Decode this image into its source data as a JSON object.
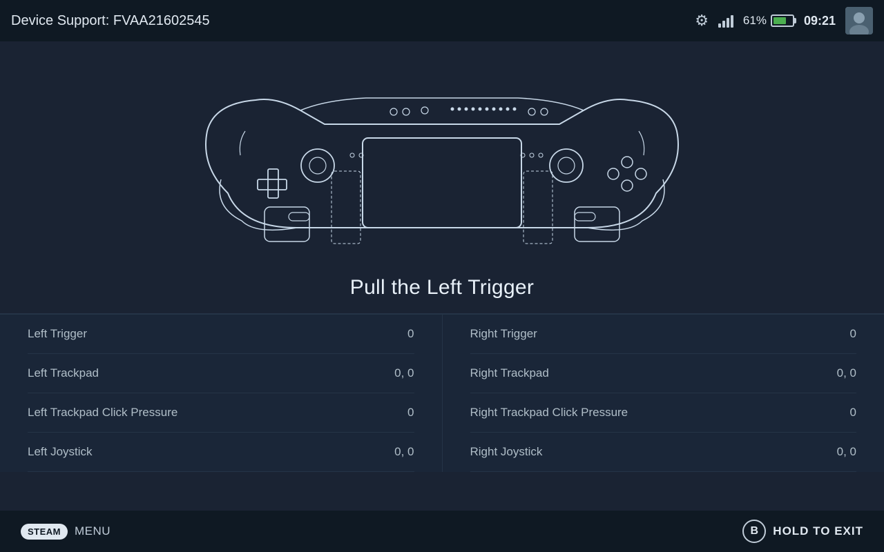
{
  "header": {
    "title": "Device Support: FVAA21602545",
    "battery_percent": "61%",
    "clock": "09:21"
  },
  "controller": {
    "prompt": "Pull the Left Trigger"
  },
  "data_rows": {
    "left": [
      {
        "label": "Left Trigger",
        "value": "0"
      },
      {
        "label": "Left Trackpad",
        "value": "0, 0"
      },
      {
        "label": "Left Trackpad Click Pressure",
        "value": "0"
      },
      {
        "label": "Left Joystick",
        "value": "0, 0"
      }
    ],
    "right": [
      {
        "label": "Right Trigger",
        "value": "0"
      },
      {
        "label": "Right Trackpad",
        "value": "0, 0"
      },
      {
        "label": "Right Trackpad Click Pressure",
        "value": "0"
      },
      {
        "label": "Right Joystick",
        "value": "0, 0"
      }
    ]
  },
  "footer": {
    "steam_label": "STEAM",
    "menu_label": "MENU",
    "b_button": "B",
    "hold_exit_label": "HOLD TO EXIT"
  }
}
